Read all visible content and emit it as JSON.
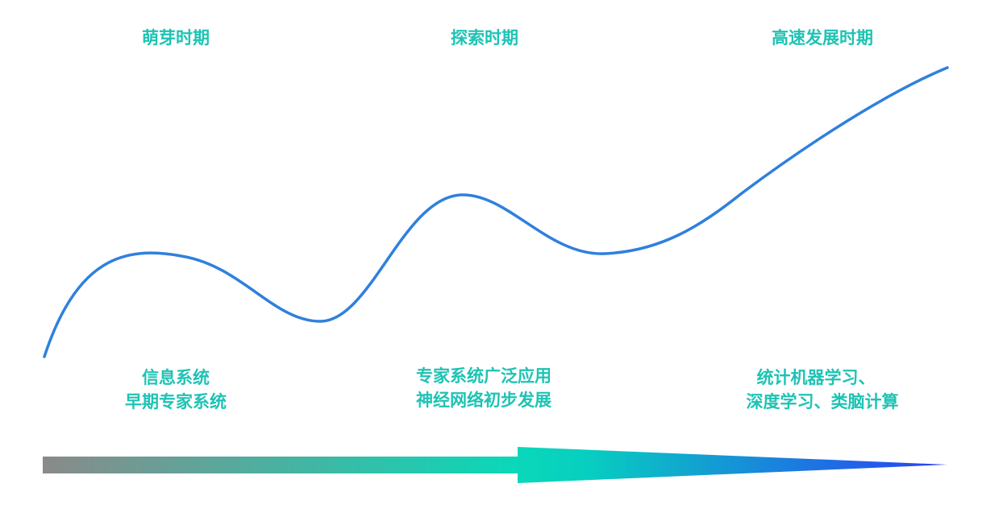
{
  "stages": [
    {
      "title": "萌芽时期",
      "desc_line1": "信息系统",
      "desc_line2": "早期专家系统"
    },
    {
      "title": "探索时期",
      "desc_line1": "专家系统广泛应用",
      "desc_line2": "神经网络初步发展"
    },
    {
      "title": "高速发展时期",
      "desc_line1": "统计机器学习、",
      "desc_line2": "深度学习、类脑计算"
    }
  ],
  "colors": {
    "text": "#1ec3b4",
    "curve": "#2f80dd",
    "arrow_start": "#8a8a8a",
    "arrow_mid": "#0ad8b8",
    "arrow_end": "#2a3ff5"
  }
}
